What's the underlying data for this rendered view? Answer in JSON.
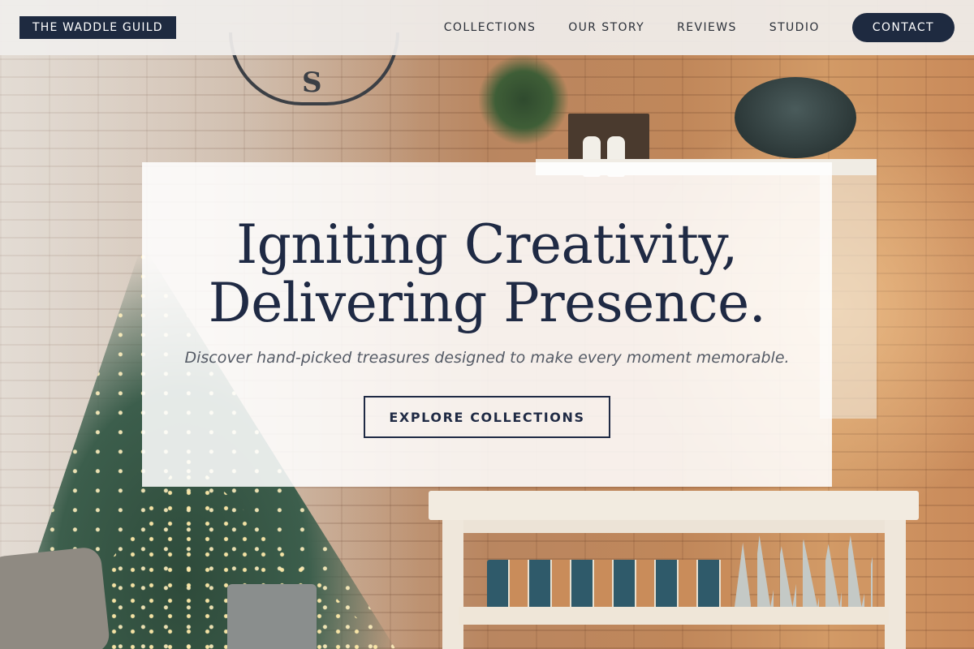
{
  "header": {
    "brand": "THE WADDLE GUILD",
    "nav": [
      "COLLECTIONS",
      "OUR STORY",
      "REVIEWS",
      "STUDIO"
    ],
    "contact_label": "CONTACT"
  },
  "hero": {
    "title_line1": "Igniting Creativity,",
    "title_line2": "Delivering Presence.",
    "subtitle": "Discover hand-picked treasures designed to make every moment memorable.",
    "cta_label": "EXPLORE COLLECTIONS"
  },
  "colors": {
    "brand_navy": "#1e2a40",
    "title_navy": "#1f2a44",
    "header_bg": "#f0eeec",
    "card_bg": "#ffffff"
  }
}
